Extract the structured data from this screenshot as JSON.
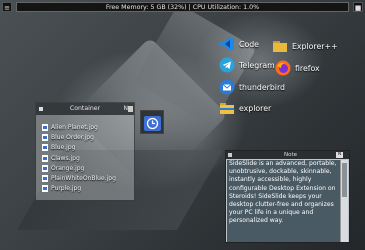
{
  "topbar": {
    "status": "Free Memory: 5 GB (32%) | CPU Utilization: 1.0%",
    "left_button": "≡",
    "right_button": "■"
  },
  "desktop_icons": [
    {
      "label": "Code",
      "icon": "vscode-icon",
      "color": "#1e88e5"
    },
    {
      "label": "Explorer++",
      "icon": "folder-icon",
      "color": "#e8b93a"
    },
    {
      "label": "Telegram",
      "icon": "telegram-icon",
      "color": "#2aa3dc"
    },
    {
      "label": "firefox",
      "icon": "firefox-icon",
      "color": "#ff6a1f"
    },
    {
      "label": "thunderbird",
      "icon": "thunderbird-icon",
      "color": "#2c7bd6"
    },
    {
      "label": "explorer",
      "icon": "folder-icon",
      "color": "#f0c040"
    }
  ],
  "container": {
    "title": "Container",
    "menu_label": "N",
    "files": [
      "Alien Planet.jpg",
      "Blue Order.jpg",
      "Blue.jpg",
      "Claws.jpg",
      "Orange.jpg",
      "PlainWhiteOnBlue.jpg",
      "Purple.jpg"
    ]
  },
  "clock_widget": {
    "icon": "clock-icon"
  },
  "note": {
    "title": "Note",
    "button_label": "N",
    "text": "SideSlide is an advanced, portable, unobtrusive, dockable, skinnable, instantly accessible, highly configurable Desktop Extension on Steroids! SideSlide keeps your desktop clutter-free and organizes your PC life in a unique and personalized way."
  },
  "colors": {
    "accent_blue": "#3d6fd6",
    "note_bg": "#4a5a64",
    "topbar_bg": "#141414"
  }
}
